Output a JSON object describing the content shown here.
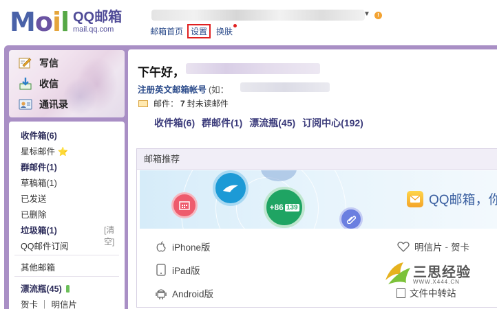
{
  "header": {
    "logo_title": "QQ邮箱",
    "logo_url": "mail.qq.com",
    "nav": [
      "邮箱首页",
      "设置",
      "换肤"
    ]
  },
  "sidebar": {
    "actions": [
      "写信",
      "收信",
      "通讯录"
    ],
    "folders": [
      {
        "label": "收件箱(6)",
        "bold": true
      },
      {
        "label": "星标邮件 ⭐",
        "bold": false
      },
      {
        "label": "群邮件(1)",
        "bold": true
      },
      {
        "label": "草稿箱(1)",
        "bold": false
      },
      {
        "label": "已发送",
        "bold": false
      },
      {
        "label": "已删除",
        "bold": false
      },
      {
        "label": "垃圾箱(1)",
        "bold": true
      },
      {
        "label": "QQ邮件订阅",
        "bold": false
      },
      {
        "label": "其他邮箱",
        "bold": false
      },
      {
        "label": "漂流瓶(45)",
        "bold": true
      },
      {
        "label": "贺卡 ｜ 明信片",
        "bold": false
      }
    ],
    "clear_label": "[清空]"
  },
  "main": {
    "greeting": "下午好，",
    "register_link": "注册英文邮箱帐号",
    "register_example": "(如：",
    "unread_prefix": "邮件：",
    "unread_count": "7",
    "unread_suffix": "封未读邮件",
    "folder_links": [
      "收件箱(6)",
      "群邮件(1)",
      "漂流瓶(45)",
      "订阅中心(192)"
    ]
  },
  "recommend": {
    "title": "邮箱推荐",
    "banner_text": "QQ邮箱，你",
    "banner_number": "+86",
    "banner_number_tail": "139",
    "items_left": [
      "iPhone版",
      "iPad版",
      "Android版"
    ],
    "items_right_1": "明信片",
    "items_right_1b": "贺卡",
    "items_right_3": "文件中转站"
  },
  "watermark": {
    "title": "三思经验",
    "sub": "WWW.X444.CN"
  }
}
